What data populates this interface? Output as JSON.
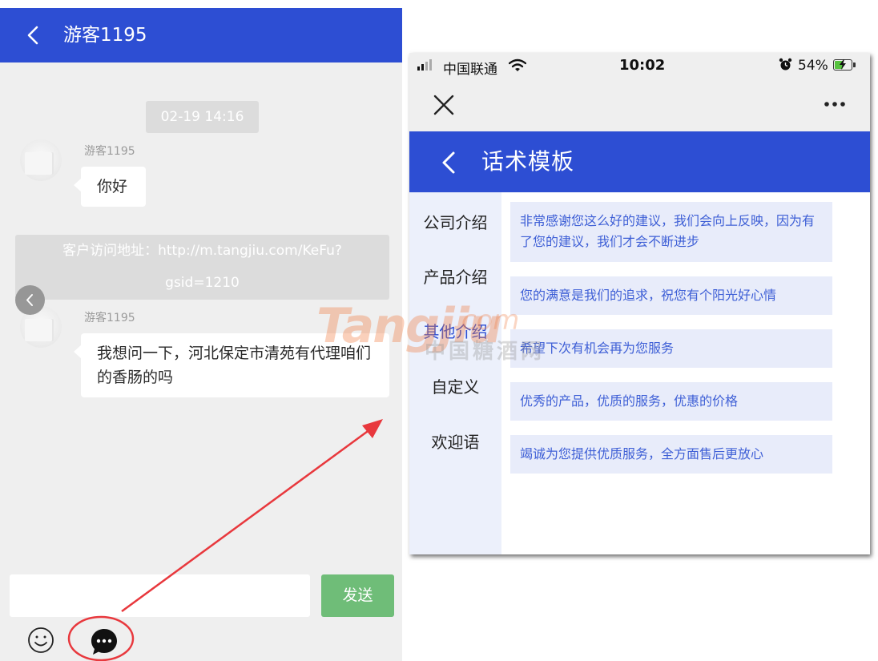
{
  "left_chat": {
    "header": {
      "title": "游客1195"
    },
    "timestamp": "02-19 14:16",
    "messages": [
      {
        "user": "游客1195",
        "text": "你好"
      },
      {
        "user": "游客1195",
        "text": "我想问一下，河北保定市清苑有代理咱们的香肠的吗"
      }
    ],
    "system_message": {
      "line1": "客户访问地址：http://m.tangjiu.com/KeFu?",
      "line2": "gsid=1210"
    },
    "input": {
      "value": "",
      "placeholder": ""
    },
    "send_label": "发送",
    "colors": {
      "header": "#2d4ed3",
      "send": "#6fbd78",
      "annotation": "#e8383d"
    }
  },
  "phone": {
    "status_bar": {
      "carrier": "中国联通",
      "time": "10:02",
      "battery": "54%",
      "battery_level": 0.54
    },
    "header": {
      "title": "话术模板"
    },
    "sidebar": {
      "items": [
        {
          "label": "公司介绍",
          "active": false
        },
        {
          "label": "产品介绍",
          "active": false
        },
        {
          "label": "其他介绍",
          "active": true
        },
        {
          "label": "自定义",
          "active": false
        },
        {
          "label": "欢迎语",
          "active": false
        }
      ]
    },
    "phrases": [
      "非常感谢您这么好的建议，我们会向上反映，因为有了您的建议，我们才会不断进步",
      "您的满意是我们的追求，祝您有个阳光好心情",
      "希望下次有机会再为您服务",
      "优秀的产品，优质的服务，优惠的价格",
      "竭诚为您提供优质服务，全方面售后更放心"
    ]
  },
  "watermark": {
    "brand": "Tangjiu",
    "domain_suffix": ".com",
    "cn": "中国糖酒网"
  },
  "icons": [
    "back-arrow-icon",
    "emoji-icon",
    "chat-bubble-icon",
    "close-icon",
    "more-icon",
    "wifi-icon",
    "alarm-icon",
    "battery-icon",
    "signal-icon"
  ]
}
